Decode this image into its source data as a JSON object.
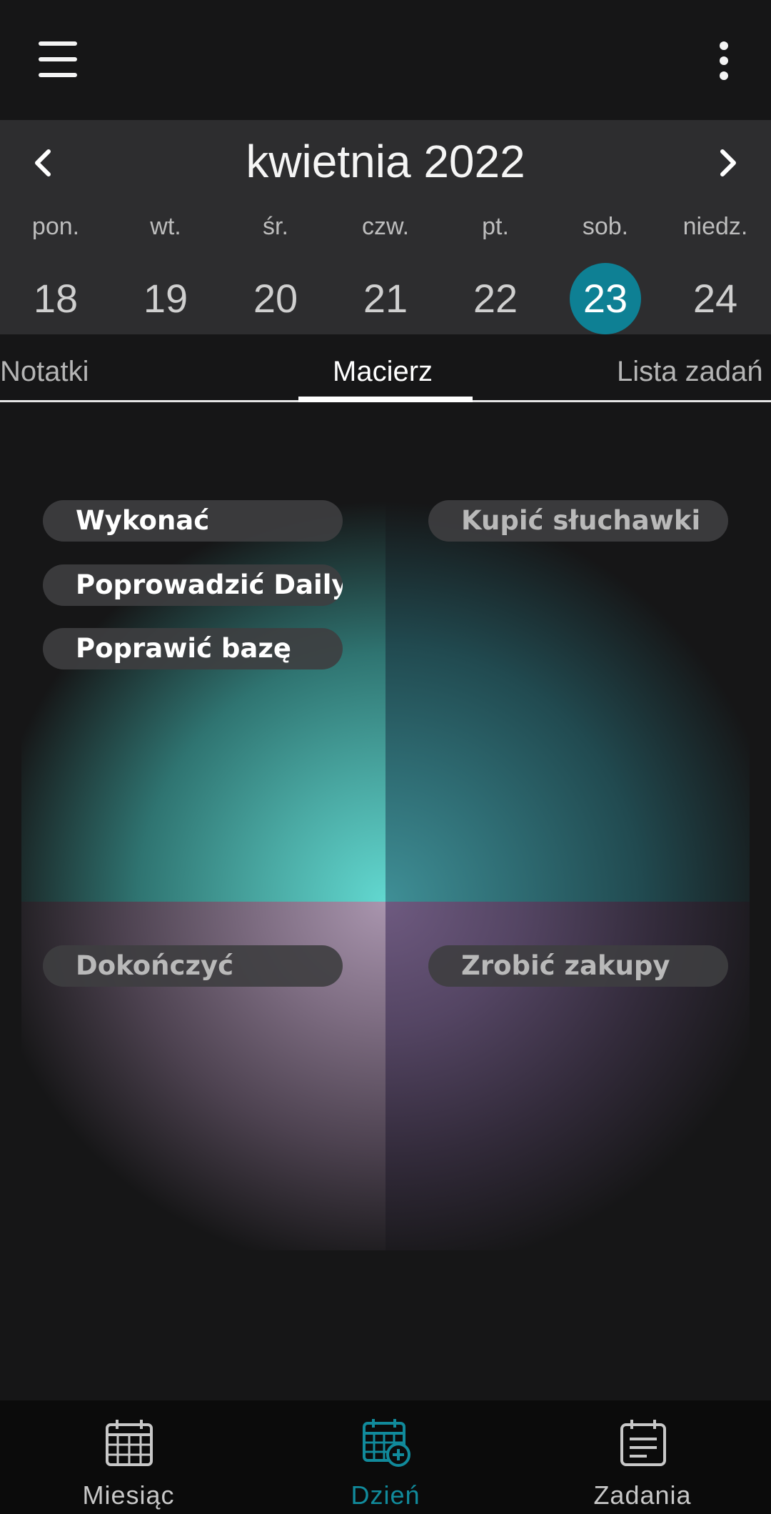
{
  "colors": {
    "accent": "#0e8094",
    "active_nav": "#118a9b",
    "background": "#161617",
    "header": "#2d2d2f"
  },
  "toolbar": {
    "menu_icon": "hamburger-menu-icon",
    "more_icon": "more-vert-icon"
  },
  "calendar": {
    "month_title": "kwietnia 2022",
    "prev_icon": "chevron-left-icon",
    "next_icon": "chevron-right-icon",
    "weekdays": [
      "pon.",
      "wt.",
      "śr.",
      "czw.",
      "pt.",
      "sob.",
      "niedz."
    ],
    "days": [
      "18",
      "19",
      "20",
      "21",
      "22",
      "23",
      "24"
    ],
    "selected_day": "23"
  },
  "tabs": [
    {
      "label": "Notatki",
      "active": false
    },
    {
      "label": "Macierz",
      "active": true
    },
    {
      "label": "Lista zadań",
      "active": false
    }
  ],
  "matrix": {
    "q1": [
      "Wykonać",
      "Poprowadzić Daily",
      "Poprawić bazę"
    ],
    "q2": [
      "Kupić słuchawki"
    ],
    "q3": [
      "Dokończyć"
    ],
    "q4": [
      "Zrobić zakupy"
    ]
  },
  "bottom_nav": [
    {
      "label": "Miesiąc",
      "icon": "calendar-month-icon",
      "active": false
    },
    {
      "label": "Dzień",
      "icon": "calendar-day-add-icon",
      "active": true
    },
    {
      "label": "Zadania",
      "icon": "task-list-icon",
      "active": false
    }
  ]
}
